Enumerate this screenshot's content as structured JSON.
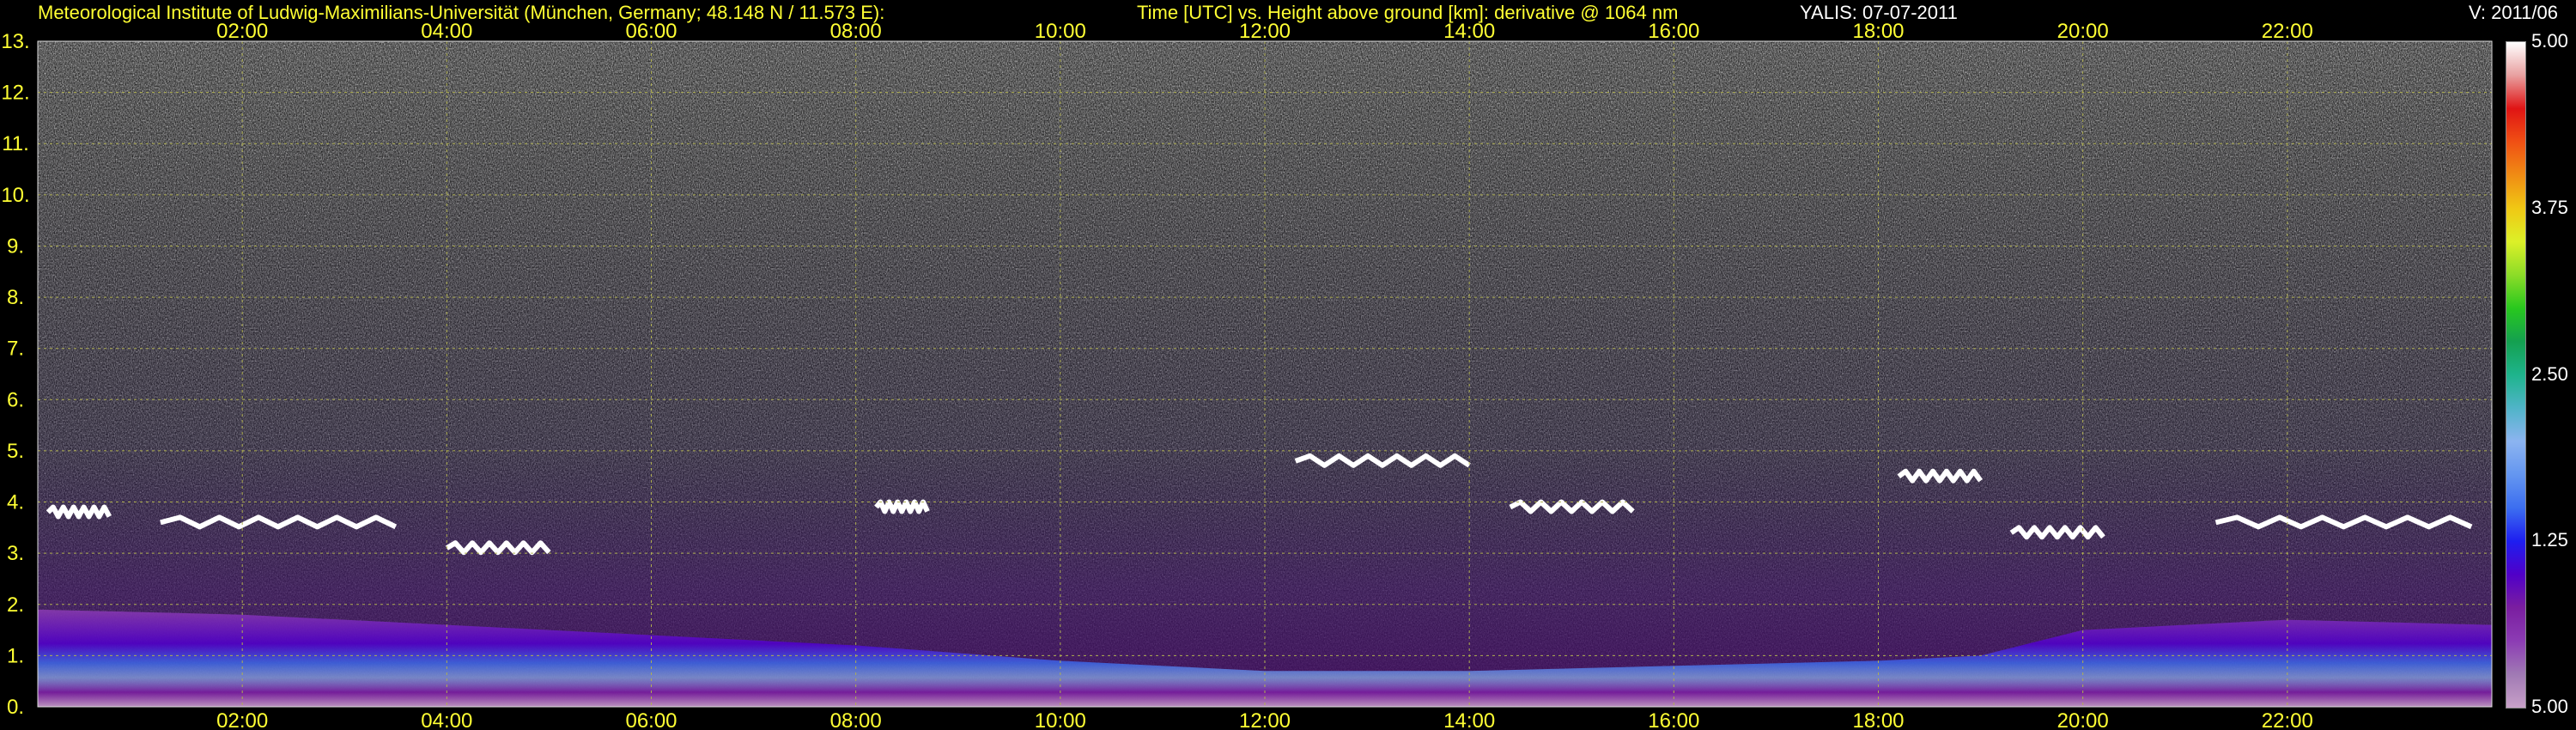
{
  "header": {
    "left": "Meteorological Institute of Ludwig-Maximilians-Universität (München, Germany; 48.148 N / 11.573 E):",
    "center": "Time [UTC] vs. Height above ground [km]: derivative @ 1064 nm",
    "station": "YALIS: 07-07-2011",
    "version": "V: 2011/06"
  },
  "colors": {
    "axis_text": "#ffff33",
    "grid": "#b0b050",
    "colorbar": [
      "#c8a0c8",
      "#a07ab4",
      "#8c3cb4",
      "#7a1ea0",
      "#5000c8",
      "#1e1ef0",
      "#3c6ef0",
      "#6496f0",
      "#8cb4f0",
      "#50b4c8",
      "#1eb48c",
      "#14a050",
      "#28c81e",
      "#8cdc28",
      "#dcf028",
      "#f0c814",
      "#f08c14",
      "#f05014",
      "#e01414",
      "#e8a0a0",
      "#ffffff"
    ]
  },
  "chart_data": {
    "type": "heatmap",
    "title": "Time [UTC] vs. Height above ground [km]: derivative @ 1064 nm",
    "xlabel": "Time [UTC]",
    "ylabel": "Height above ground [km]",
    "x_ticks": [
      "02:00",
      "04:00",
      "06:00",
      "08:00",
      "10:00",
      "12:00",
      "14:00",
      "16:00",
      "18:00",
      "20:00",
      "22:00"
    ],
    "x_tick_hours": [
      2,
      4,
      6,
      8,
      10,
      12,
      14,
      16,
      18,
      20,
      22
    ],
    "xlim": [
      0,
      24
    ],
    "y_ticks": [
      "0.",
      "1.",
      "2.",
      "3.",
      "4.",
      "5.",
      "6.",
      "7.",
      "8.",
      "9.",
      "10.",
      "11.",
      "12.",
      "13."
    ],
    "y_tick_values": [
      0,
      1,
      2,
      3,
      4,
      5,
      6,
      7,
      8,
      9,
      10,
      11,
      12,
      13
    ],
    "ylim": [
      0,
      13
    ],
    "colorbar_ticks": [
      "5.00",
      "1.25",
      "2.50",
      "3.75",
      "5.00"
    ],
    "colorbar_tick_fraction": [
      0,
      0.25,
      0.5,
      0.75,
      1
    ],
    "grid": true,
    "features": {
      "boundary_layer": [
        [
          0,
          1.9
        ],
        [
          2,
          1.8
        ],
        [
          4,
          1.6
        ],
        [
          6,
          1.4
        ],
        [
          8,
          1.2
        ],
        [
          10,
          0.9
        ],
        [
          12,
          0.7
        ],
        [
          14,
          0.7
        ],
        [
          16,
          0.8
        ],
        [
          18,
          0.9
        ],
        [
          19,
          1.0
        ],
        [
          20,
          1.5
        ],
        [
          22,
          1.7
        ],
        [
          24,
          1.6
        ]
      ],
      "cloud_layers": [
        {
          "x0": 0.1,
          "x1": 0.7,
          "y": 3.8
        },
        {
          "x0": 1.2,
          "x1": 3.5,
          "y": 3.6
        },
        {
          "x0": 4.0,
          "x1": 5.0,
          "y": 3.1
        },
        {
          "x0": 8.2,
          "x1": 8.7,
          "y": 3.9
        },
        {
          "x0": 12.3,
          "x1": 14.0,
          "y": 4.8
        },
        {
          "x0": 14.4,
          "x1": 15.6,
          "y": 3.9
        },
        {
          "x0": 18.2,
          "x1": 19.0,
          "y": 4.5
        },
        {
          "x0": 19.3,
          "x1": 20.2,
          "y": 3.4
        },
        {
          "x0": 21.3,
          "x1": 23.8,
          "y": 3.6
        }
      ]
    }
  }
}
